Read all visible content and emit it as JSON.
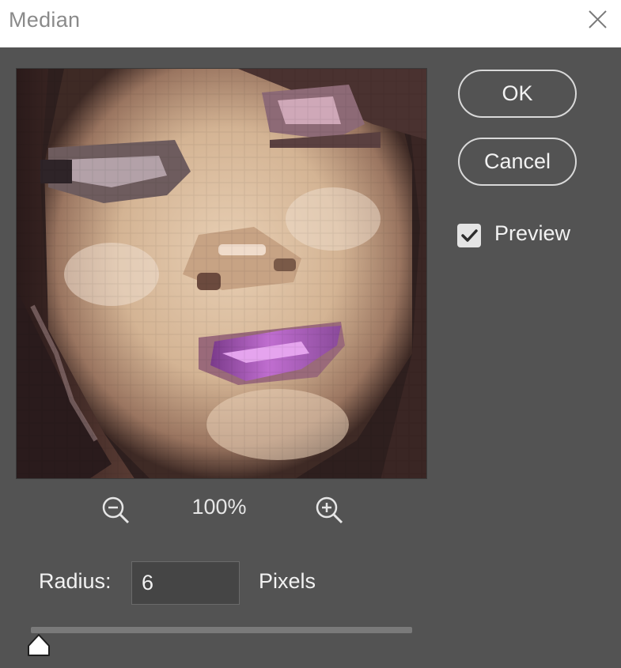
{
  "dialog": {
    "title": "Median",
    "close_icon": "close-icon"
  },
  "preview": {
    "zoom_level": "100%",
    "zoom_out_icon": "zoom-out-icon",
    "zoom_in_icon": "zoom-in-icon"
  },
  "buttons": {
    "ok_label": "OK",
    "cancel_label": "Cancel"
  },
  "options": {
    "preview_label": "Preview",
    "preview_checked": true
  },
  "radius": {
    "label": "Radius:",
    "value": "6",
    "units": "Pixels",
    "slider_position": 0.02
  },
  "colors": {
    "dialog_bg": "#535353",
    "title_bar_bg": "#ffffff",
    "button_border": "#d9d9d9",
    "text": "#f2f2f2"
  }
}
